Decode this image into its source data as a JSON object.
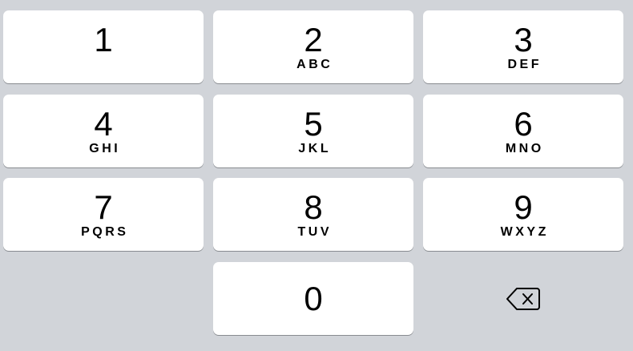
{
  "keys": [
    {
      "digit": "1",
      "letters": ""
    },
    {
      "digit": "2",
      "letters": "ABC"
    },
    {
      "digit": "3",
      "letters": "DEF"
    },
    {
      "digit": "4",
      "letters": "GHI"
    },
    {
      "digit": "5",
      "letters": "JKL"
    },
    {
      "digit": "6",
      "letters": "MNO"
    },
    {
      "digit": "7",
      "letters": "PQRS"
    },
    {
      "digit": "8",
      "letters": "TUV"
    },
    {
      "digit": "9",
      "letters": "WXYZ"
    },
    {
      "digit": "0",
      "letters": ""
    }
  ],
  "delete_key": {
    "icon": "backspace-icon"
  },
  "colors": {
    "background": "#d1d4d9",
    "key": "#ffffff",
    "key_shadow": "#888b90",
    "text": "#000000"
  }
}
